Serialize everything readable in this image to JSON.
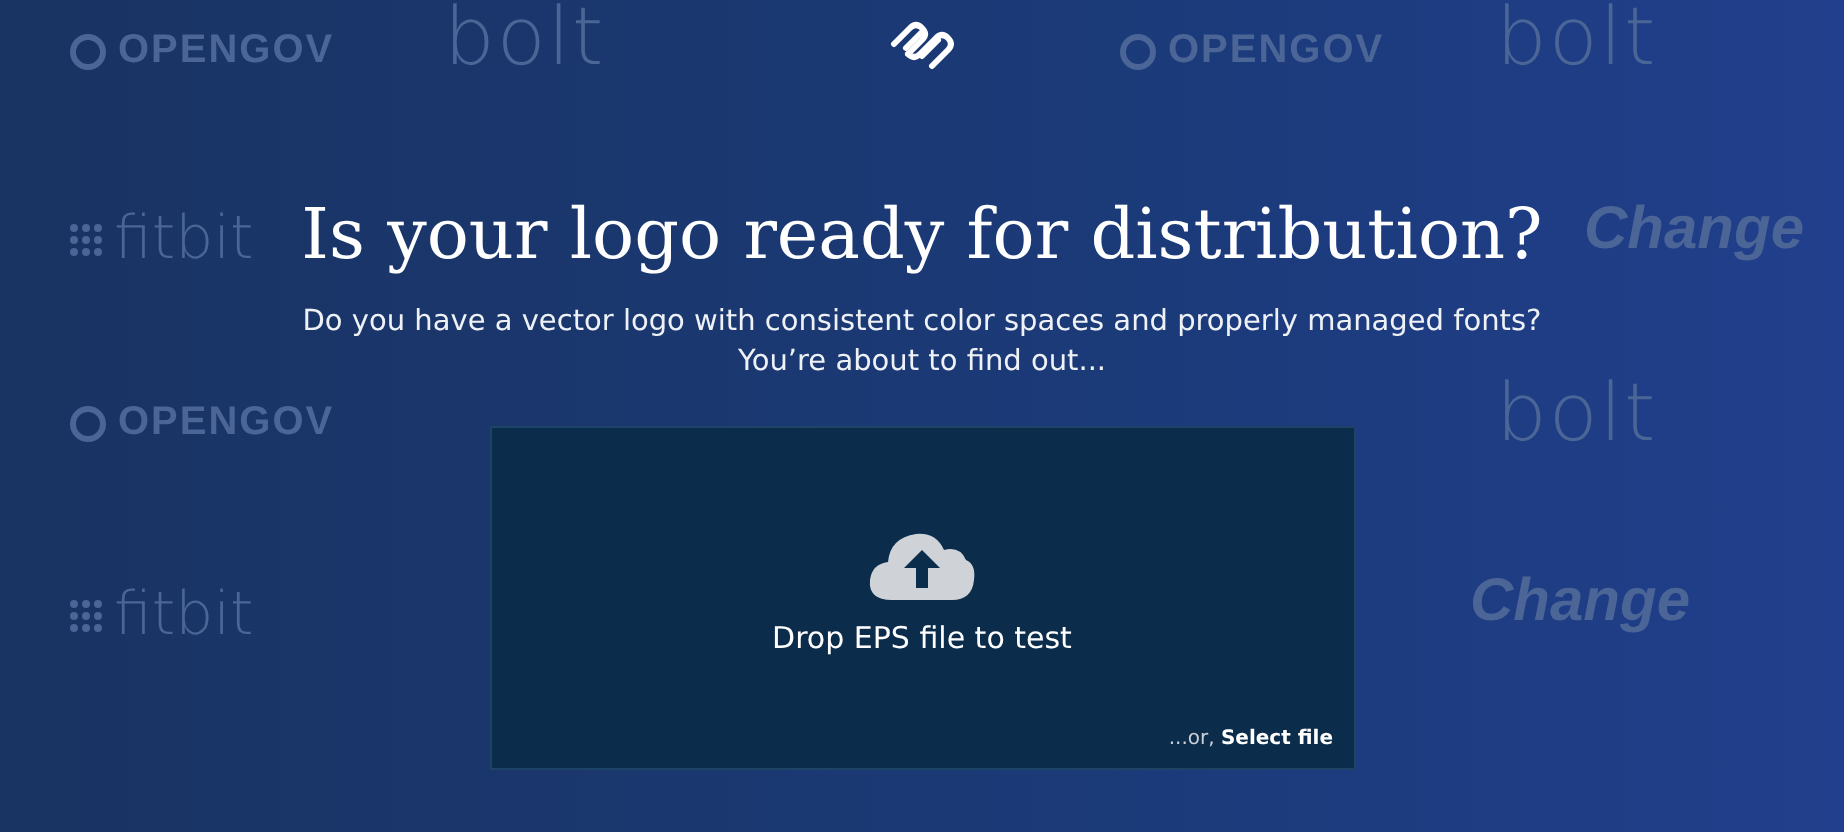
{
  "background_logos": [
    {
      "kind": "opengov",
      "text": "OPENGOV"
    },
    {
      "kind": "bolt",
      "text": "bolt"
    },
    {
      "kind": "opengov",
      "text": "OPENGOV"
    },
    {
      "kind": "bolt",
      "text": "bolt"
    },
    {
      "kind": "fitbit",
      "text": "fitbit"
    },
    {
      "kind": "change",
      "text": "Change"
    },
    {
      "kind": "opengov",
      "text": "OPENGOV"
    },
    {
      "kind": "bolt",
      "text": "bolt"
    },
    {
      "kind": "fitbit",
      "text": "fitbit"
    },
    {
      "kind": "change",
      "text": "Change"
    }
  ],
  "heading": "Is your logo ready for distribution?",
  "subheading": [
    "Do you have a vector logo with consistent color spaces and properly managed fonts?",
    "You’re about to find out..."
  ],
  "dropzone": {
    "label": "Drop EPS file to test",
    "alt_prefix": "...or,",
    "alt_link": "Select file"
  }
}
